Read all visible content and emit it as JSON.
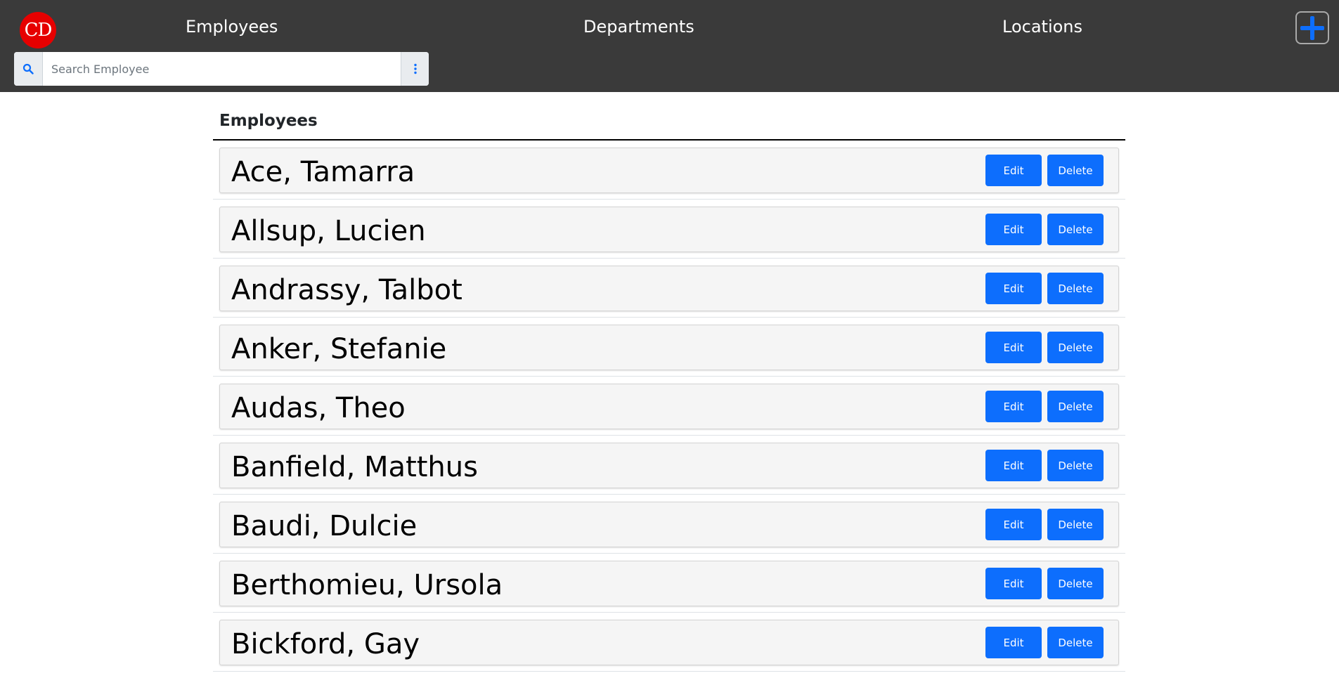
{
  "header": {
    "logo_text": "CD",
    "nav": {
      "employees": "Employees",
      "departments": "Departments",
      "locations": "Locations"
    },
    "add_icon": "plus-icon",
    "search": {
      "placeholder": "Search Employee",
      "icon": "search-icon",
      "menu_icon": "vertical-ellipsis-icon"
    }
  },
  "main": {
    "section_title": "Employees",
    "edit_label": "Edit",
    "delete_label": "Delete",
    "employees": [
      "Ace, Tamarra",
      "Allsup, Lucien",
      "Andrassy, Talbot",
      "Anker, Stefanie",
      "Audas, Theo",
      "Banfield, Matthus",
      "Baudi, Dulcie",
      "Berthomieu, Ursola",
      "Bickford, Gay"
    ]
  },
  "colors": {
    "header_bg": "#3a3a3a",
    "logo_red": "#e60000",
    "accent_blue": "#0d6efd",
    "card_bg": "#f5f5f5"
  }
}
